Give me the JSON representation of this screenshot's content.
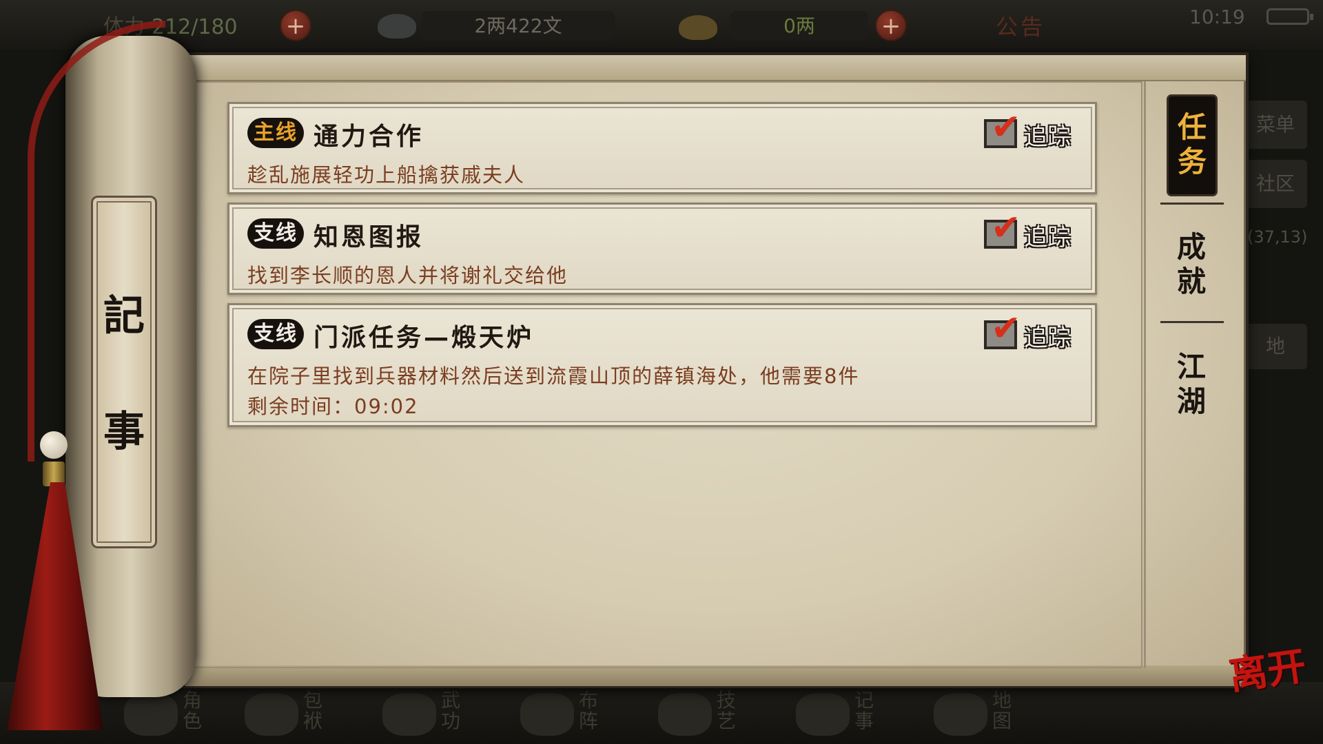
{
  "hud": {
    "stamina_label": "体力",
    "stamina_value": "212/180",
    "copper": "2两422文",
    "gold": "0两",
    "notice": "公告",
    "clock": "10:19",
    "side_menu": "菜单",
    "side_community": "社区",
    "coords": "(37,13)",
    "side_map": "地"
  },
  "scroll_title": [
    "記",
    "事"
  ],
  "quests": [
    {
      "tag": "主线",
      "title": "通力合作",
      "desc_lines": [
        "趁乱施展轻功上船擒获戚夫人"
      ],
      "track_label": "追踪"
    },
    {
      "tag": "支线",
      "title": "知恩图报",
      "desc_lines": [
        "找到李长顺的恩人并将谢礼交给他"
      ],
      "track_label": "追踪"
    },
    {
      "tag": "支线",
      "title": "门派任务—煅天炉",
      "desc_lines": [
        "在院子里找到兵器材料然后送到流霞山顶的薛镇海处，他需要8件",
        "剩余时间：09:02"
      ],
      "track_label": "追踪"
    }
  ],
  "tabs": [
    {
      "label_top": "任",
      "label_bottom": "务",
      "active": true
    },
    {
      "label_top": "成",
      "label_bottom": "就",
      "active": false
    },
    {
      "label_top": "江",
      "label_bottom": "湖",
      "active": false
    }
  ],
  "bottom_nav": [
    "角色",
    "包袱",
    "武功",
    "布阵",
    "技艺",
    "记事",
    "地图"
  ],
  "leave_label": "离开",
  "colors": {
    "main_tag": "#e8a22a",
    "tick": "#d6301a",
    "active_tab_text": "#eeb23b",
    "desc_text": "#7a3d20"
  }
}
